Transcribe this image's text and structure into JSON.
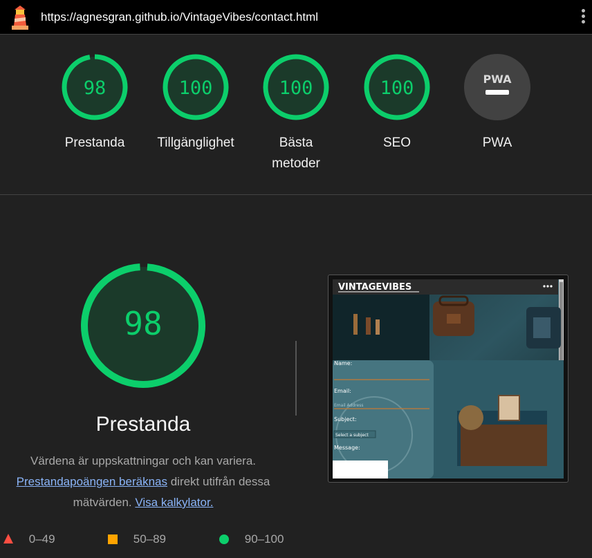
{
  "header": {
    "url": "https://agnesgran.github.io/VintageVibes/contact.html"
  },
  "colors": {
    "pass": "#0cce6b",
    "pass_fill": "#1b3a2a",
    "average": "#ffa400",
    "fail": "#ff4e42",
    "pwa_bg": "#424242"
  },
  "gauges": [
    {
      "score": "98",
      "label": "Prestanda"
    },
    {
      "score": "100",
      "label": "Tillgänglighet"
    },
    {
      "score": "100",
      "label": "Bästa metoder"
    },
    {
      "score": "100",
      "label": "SEO"
    },
    {
      "score": "",
      "label": "PWA",
      "badge": "PWA"
    }
  ],
  "main": {
    "score": "98",
    "title": "Prestanda",
    "desc_line1": "Värdena är uppskattningar och kan variera.",
    "desc_link1": "Prestandapoängen beräknas",
    "desc_mid": " direkt utifrån dessa mätvärden. ",
    "desc_link2": "Visa kalkylator."
  },
  "screenshot": {
    "brand": "VINTAGEVIBES",
    "form": {
      "name_label": "Name:",
      "email_label": "Email:",
      "email_placeholder": "Email Address",
      "subject_label": "Subject:",
      "subject_value": "Select a subject",
      "message_label": "Message:"
    }
  },
  "legend": {
    "fail": "0–49",
    "average": "50–89",
    "pass": "90–100"
  }
}
